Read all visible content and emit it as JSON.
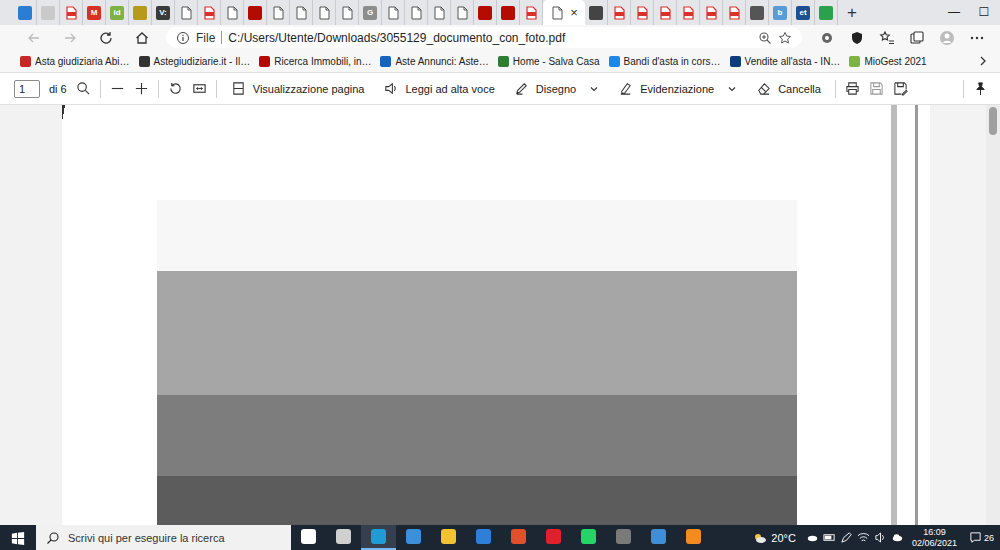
{
  "window": {
    "controls": [
      "—",
      "☐"
    ]
  },
  "tabs": [
    {
      "kind": "badge",
      "icon": "",
      "color": "#2b7cd3",
      "selected": false
    },
    {
      "kind": "badge",
      "icon": "",
      "color": "#c9c9c9",
      "selected": false
    },
    {
      "kind": "pdf",
      "icon": "",
      "color": "#d9312b",
      "selected": false
    },
    {
      "kind": "badge",
      "icon": "M",
      "color": "#d93025",
      "selected": false
    },
    {
      "kind": "badge",
      "icon": "id",
      "color": "#7cb342",
      "selected": false
    },
    {
      "kind": "badge",
      "icon": "",
      "color": "#b59a1c",
      "selected": false
    },
    {
      "kind": "badge",
      "icon": "V:",
      "color": "#3a3a3a",
      "selected": false
    },
    {
      "kind": "doc",
      "icon": "",
      "color": "#ffffff",
      "selected": false
    },
    {
      "kind": "pdf",
      "icon": "",
      "color": "#d9312b",
      "selected": false
    },
    {
      "kind": "doc",
      "icon": "",
      "color": "#ffffff",
      "selected": false
    },
    {
      "kind": "badge",
      "icon": "",
      "color": "#b30b00",
      "selected": false
    },
    {
      "kind": "doc",
      "icon": "",
      "color": "#ffffff",
      "selected": false
    },
    {
      "kind": "doc",
      "icon": "",
      "color": "#ffffff",
      "selected": false
    },
    {
      "kind": "doc",
      "icon": "",
      "color": "#ffffff",
      "selected": false
    },
    {
      "kind": "doc",
      "icon": "",
      "color": "#ffffff",
      "selected": false
    },
    {
      "kind": "badge",
      "icon": "G",
      "color": "#8d8d8d",
      "selected": false
    },
    {
      "kind": "doc",
      "icon": "",
      "color": "#ffffff",
      "selected": false
    },
    {
      "kind": "doc",
      "icon": "",
      "color": "#ffffff",
      "selected": false
    },
    {
      "kind": "doc",
      "icon": "",
      "color": "#ffffff",
      "selected": false
    },
    {
      "kind": "doc",
      "icon": "",
      "color": "#ffffff",
      "selected": false
    },
    {
      "kind": "badge",
      "icon": "",
      "color": "#b30b00",
      "selected": false
    },
    {
      "kind": "badge",
      "icon": "",
      "color": "#b30b00",
      "selected": false
    },
    {
      "kind": "pdf",
      "icon": "",
      "color": "#d9312b",
      "selected": false
    },
    {
      "kind": "doc",
      "icon": "",
      "color": "#ffffff",
      "selected": true
    },
    {
      "kind": "badge",
      "icon": "",
      "color": "#444444",
      "selected": false
    },
    {
      "kind": "pdf",
      "icon": "",
      "color": "#d9312b",
      "selected": false
    },
    {
      "kind": "pdf",
      "icon": "",
      "color": "#d9312b",
      "selected": false
    },
    {
      "kind": "pdf",
      "icon": "",
      "color": "#d9312b",
      "selected": false
    },
    {
      "kind": "pdf",
      "icon": "",
      "color": "#d9312b",
      "selected": false
    },
    {
      "kind": "pdf",
      "icon": "",
      "color": "#d9312b",
      "selected": false
    },
    {
      "kind": "pdf",
      "icon": "",
      "color": "#d9312b",
      "selected": false
    },
    {
      "kind": "badge",
      "icon": "",
      "color": "#555555",
      "selected": false
    },
    {
      "kind": "badge",
      "icon": "b",
      "color": "#5b9bd5",
      "selected": false
    },
    {
      "kind": "badge",
      "icon": "et",
      "color": "#1d4f91",
      "selected": false
    },
    {
      "kind": "badge",
      "icon": "",
      "color": "#2aa14a",
      "selected": false
    }
  ],
  "tab_close": "×",
  "new_tab": "+",
  "address_bar": {
    "scheme": "File",
    "url": "C:/Users/Utente/Downloads/3055129_documento_con_foto.pdf"
  },
  "bookmarks": [
    {
      "label": "Asta giudiziaria Abi…",
      "color": "#c62828"
    },
    {
      "label": "Astegiudiziarie.it - Il…",
      "color": "#333333"
    },
    {
      "label": "Ricerca Immobili, in…",
      "color": "#b30b00"
    },
    {
      "label": "Aste Annunci: Aste…",
      "color": "#1565c0"
    },
    {
      "label": "Home - Salva Casa",
      "color": "#2e7d32"
    },
    {
      "label": "Bandi d'asta in cors…",
      "color": "#1e88e5"
    },
    {
      "label": "Vendite all'asta - IN…",
      "color": "#0d3c7a"
    },
    {
      "label": "MioGest 2021",
      "color": "#7cb342"
    }
  ],
  "pdf_toolbar": {
    "page": "1",
    "page_count": "di 6",
    "buttons": [
      {
        "label": "Visualizzazione pagina",
        "dropdown": false
      },
      {
        "label": "Leggi ad alta voce",
        "dropdown": false
      },
      {
        "label": "Disegno",
        "dropdown": true
      },
      {
        "label": "Evidenziazione",
        "dropdown": true
      },
      {
        "label": "Cancella",
        "dropdown": false
      }
    ]
  },
  "taskbar": {
    "search_placeholder": "Scrivi qui per eseguire la ricerca",
    "apps": [
      {
        "color": "#ffffff",
        "selected": false
      },
      {
        "color": "#d0d0d0",
        "selected": false
      },
      {
        "color": "#1f9bd8",
        "selected": true
      },
      {
        "color": "#3c8fd8",
        "selected": false
      },
      {
        "color": "#f2c230",
        "selected": false
      },
      {
        "color": "#2f7ed8",
        "selected": false
      },
      {
        "color": "#e2502b",
        "selected": false
      },
      {
        "color": "#e0202a",
        "selected": false
      },
      {
        "color": "#25d366",
        "selected": false
      },
      {
        "color": "#7a7a7a",
        "selected": false
      },
      {
        "color": "#3f8fd8",
        "selected": false
      },
      {
        "color": "#f28b20",
        "selected": false
      }
    ],
    "weather": "20°C",
    "time": "16:09",
    "date": "02/06/2021",
    "notifications": "26"
  }
}
